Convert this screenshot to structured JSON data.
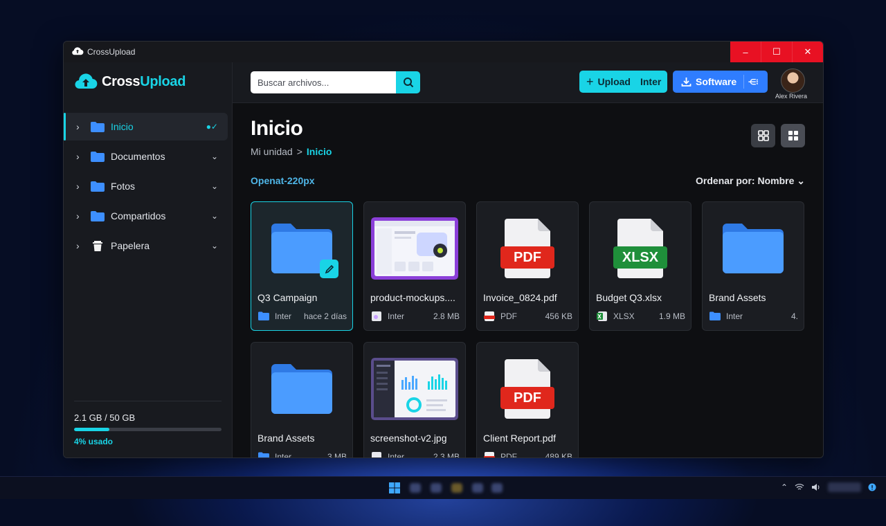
{
  "window": {
    "title": "CrossUpload",
    "controls": [
      "–",
      "☐",
      "✕"
    ]
  },
  "sidebar": {
    "brand": {
      "part1": "Cross",
      "part2": "Upload"
    },
    "items": [
      {
        "label": "Inicio",
        "icon": "folder-icon",
        "active": true,
        "right": "●✓"
      },
      {
        "label": "Documentos",
        "icon": "folder-icon",
        "active": false,
        "right": "⌄"
      },
      {
        "label": "Fotos",
        "icon": "folder-icon",
        "active": false,
        "right": "⌄"
      },
      {
        "label": "Compartidos",
        "icon": "folder-icon",
        "active": false,
        "right": "⌄"
      },
      {
        "label": "Papelera",
        "icon": "trash-icon",
        "active": false,
        "right": "⌄"
      }
    ],
    "storage": {
      "used": "2.1 GB / 50 GB",
      "percent_label": "4% usado",
      "percent": 4
    }
  },
  "topbar": {
    "search_placeholder": "Buscar archivos...",
    "upload": {
      "label": "Upload",
      "extra": "Inter"
    },
    "software": {
      "label": "Software",
      "extra": "⋲⁝"
    },
    "user_name": "Alex Rivera"
  },
  "main": {
    "title": "Inicio",
    "breadcrumb": {
      "root": "Mi unidad",
      "sep": ">",
      "current": "Inicio"
    },
    "section_label": "Openat-220px",
    "sort_label": "Ordenar por: Nombre",
    "files": [
      {
        "name": "Q3 Campaign",
        "kind": "folder",
        "type_label": "Inter",
        "right": "hace 2 días",
        "selected": true,
        "editable": true
      },
      {
        "name": "product-mockups....",
        "kind": "image-purple",
        "type_label": "Inter",
        "right": "2.8 MB"
      },
      {
        "name": "Invoice_0824.pdf",
        "kind": "pdf",
        "tag": "PDF",
        "type_label": "PDF",
        "right": "456 KB"
      },
      {
        "name": "Budget Q3.xlsx",
        "kind": "xlsx",
        "tag": "XLSX",
        "type_label": "XLSX",
        "right": "1.9 MB"
      },
      {
        "name": "Brand Assets",
        "kind": "folder",
        "type_label": "Inter",
        "right": "4."
      },
      {
        "name": "Brand Assets",
        "kind": "folder",
        "type_label": "Inter",
        "right": "3 MB"
      },
      {
        "name": "screenshot-v2.jpg",
        "kind": "image-dashboard",
        "type_label": "Inter",
        "right": "2.3 MB"
      },
      {
        "name": "Client Report.pdf",
        "kind": "pdf",
        "tag": "PDF",
        "type_label": "PDF",
        "right": "489 KB"
      }
    ]
  },
  "colors": {
    "accent": "#19d4e6",
    "primary": "#2f7dff",
    "close_red": "#e81123",
    "pdf_red": "#e0271c",
    "xlsx_green": "#1f8f3a"
  }
}
